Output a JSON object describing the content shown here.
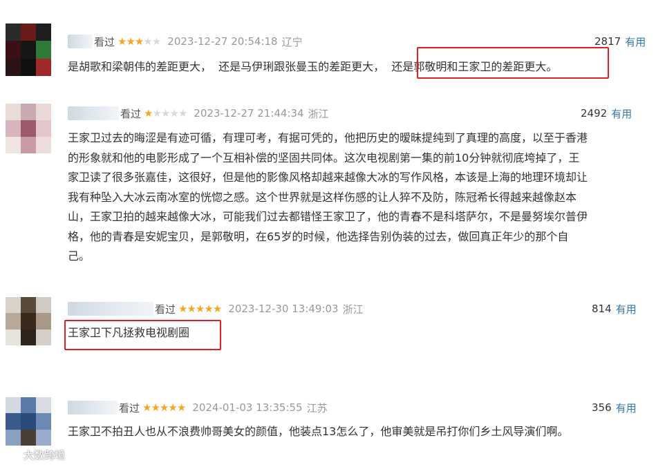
{
  "comments": [
    {
      "seen_label": "看过",
      "stars_filled": 3,
      "stars_total": 5,
      "time": "2023-12-27 20:54:18",
      "location": "辽宁",
      "votes": "2817",
      "useful_label": "有用",
      "text": "是胡歌和梁朝伟的差距更大，  还是马伊琍跟张曼玉的差距更大，  还是郭敬明和王家卫的差距更大。"
    },
    {
      "seen_label": "看过",
      "stars_filled": 1,
      "stars_total": 5,
      "time": "2023-12-27 21:44:34",
      "location": "浙江",
      "votes": "2492",
      "useful_label": "有用",
      "text": "王家卫过去的晦涩是有迹可循，有理可考，有据可凭的，他把历史的暧昧提纯到了真理的高度，以至于香港\n的形象就和他的电影形成了一个互相补偿的坚固共同体。这次电视剧第一集的前10分钟就彻底垮掉了，王\n家卫读了很多张嘉佳，这很好，但是他的影像风格却越来越像大冰的写作风格，本该是上海的地理环境却让\n我有种坠入大冰云南冰室的恍惚之感。这个世界就是这样伤感的让人猝不及防，陈冠希长得越来越像赵本\n山，王家卫拍的越来越像大冰，可能我们过去都错怪王家卫了，他的青春不是科塔萨尔，不是曼努埃尔普伊\n格，他的青春是安妮宝贝，是郭敬明，在65岁的时候，他选择告别伪装的过去，做回真正年少的那个自\n己。"
    },
    {
      "seen_label": "看过",
      "stars_filled": 5,
      "stars_total": 5,
      "time": "2023-12-30 13:49:03",
      "location": "浙江",
      "votes": "814",
      "useful_label": "有用",
      "text": "王家卫下凡拯救电视剧圈"
    },
    {
      "seen_label": "看过",
      "stars_filled": 5,
      "stars_total": 5,
      "time": "2024-01-03 13:35:55",
      "location": "江苏",
      "votes": "356",
      "useful_label": "有用",
      "text": "王家卫不拍丑人也从不浪费帅哥美女的颜值，他装点13怎么了，他审美就是吊打你们乡土风导演们啊。"
    }
  ],
  "watermark": "大数跨境",
  "colors": {
    "star_on": "#f5a623",
    "star_off": "#d9d9d9",
    "link": "#3377aa",
    "highlight": "#e02020",
    "meta": "#999999"
  }
}
